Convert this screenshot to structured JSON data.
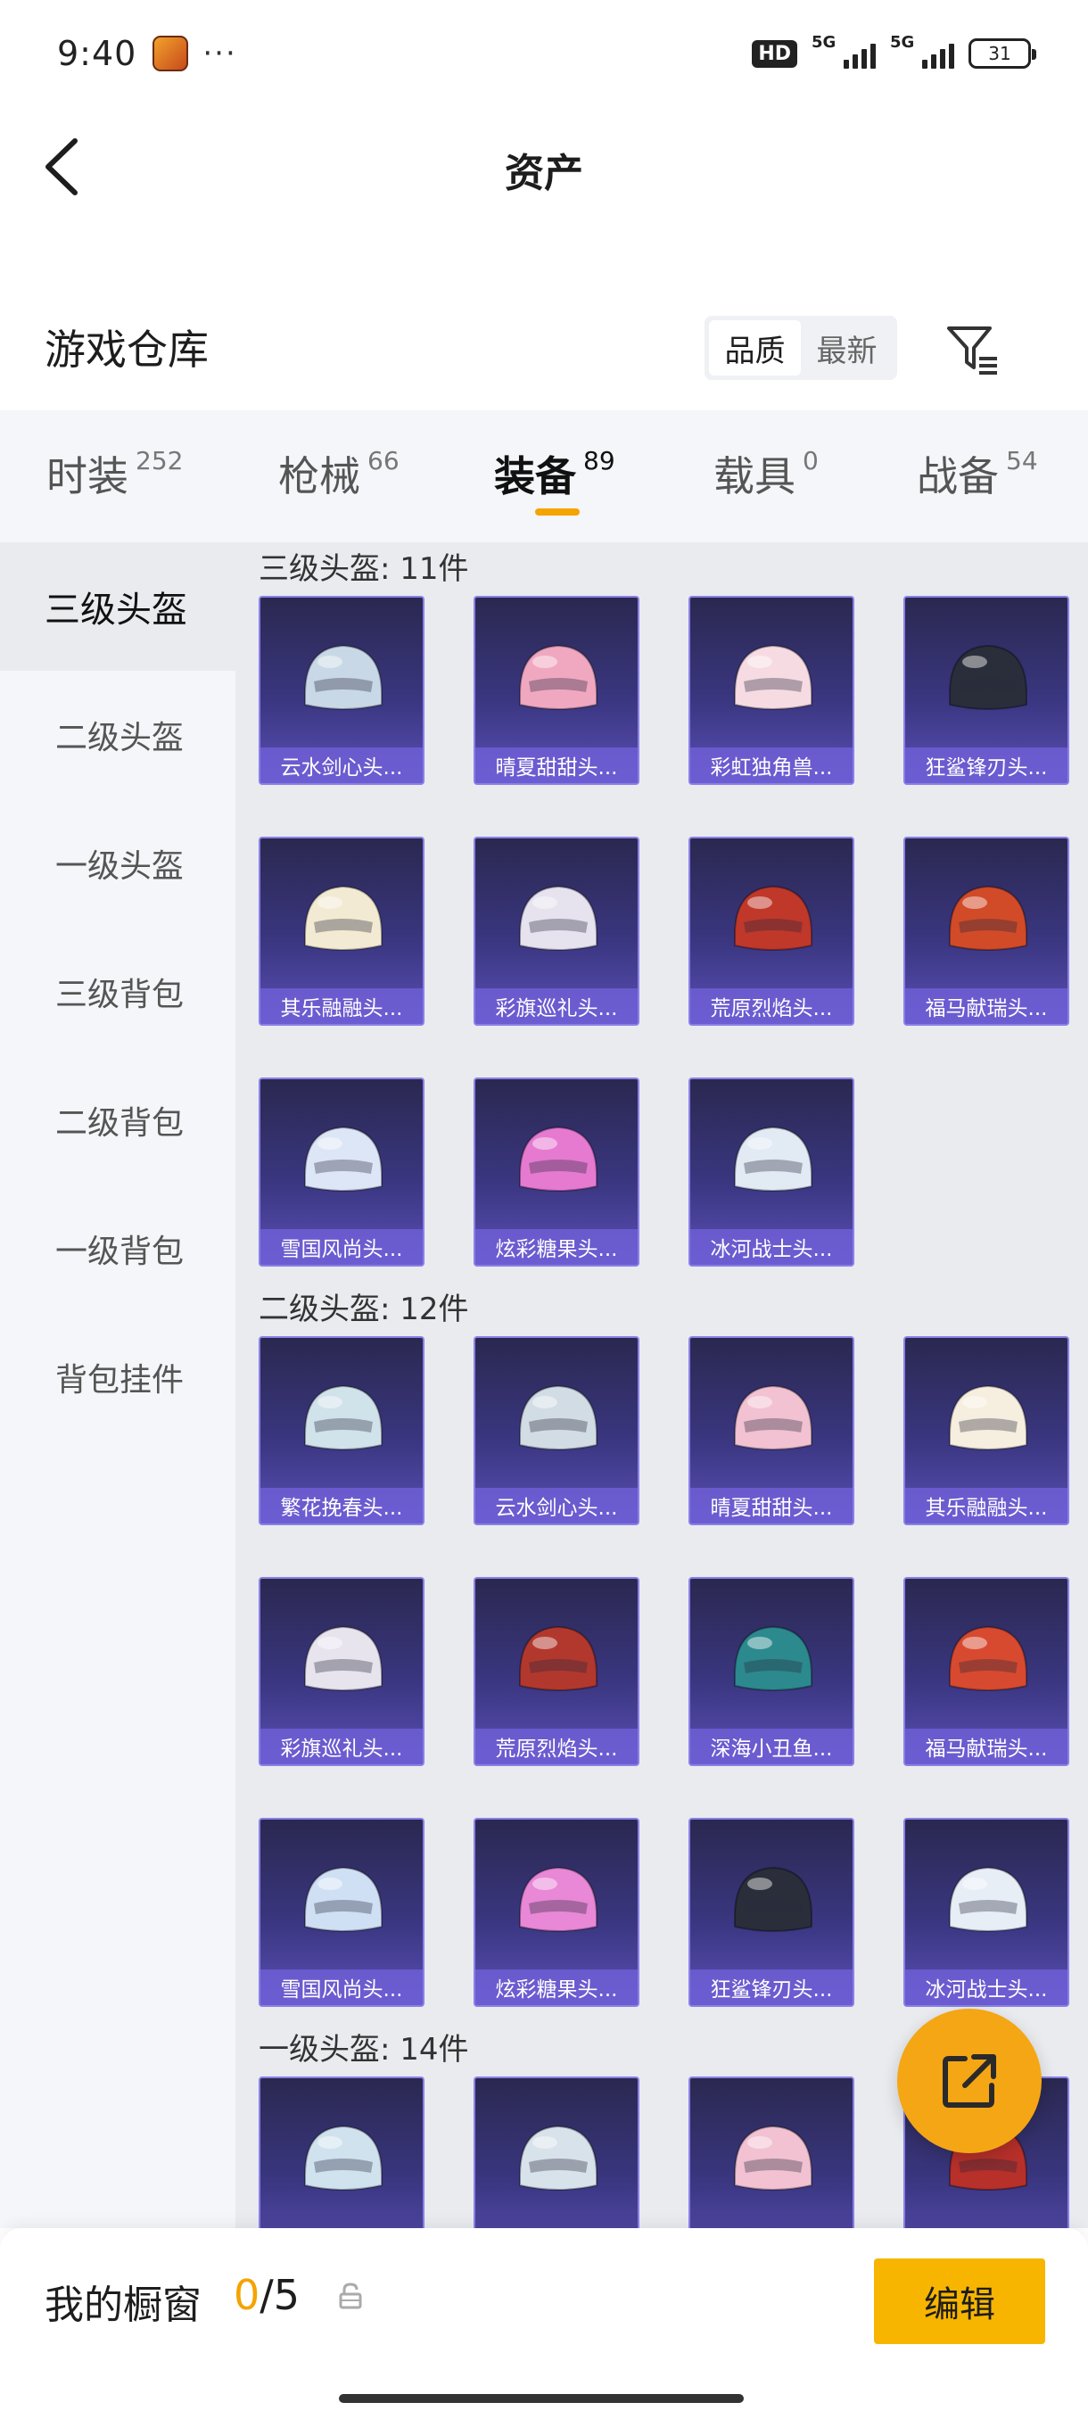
{
  "status_bar": {
    "time": "9:40",
    "dots": "···",
    "hd": "HD",
    "network_a": "5G",
    "network_b": "5G",
    "battery": "31"
  },
  "header": {
    "title": "资产"
  },
  "warehouse": {
    "title": "游戏仓库",
    "sort_options": [
      {
        "label": "品质",
        "active": true
      },
      {
        "label": "最新",
        "active": false
      }
    ]
  },
  "tabs": [
    {
      "label": "时装",
      "count": "252"
    },
    {
      "label": "枪械",
      "count": "66"
    },
    {
      "label": "装备",
      "count": "89",
      "active": true
    },
    {
      "label": "载具",
      "count": "0"
    },
    {
      "label": "战备",
      "count": "54"
    }
  ],
  "sidebar": [
    {
      "label": "三级头盔",
      "active": true
    },
    {
      "label": "二级头盔"
    },
    {
      "label": "一级头盔"
    },
    {
      "label": "三级背包"
    },
    {
      "label": "二级背包"
    },
    {
      "label": "一级背包"
    },
    {
      "label": "背包挂件"
    }
  ],
  "sections": [
    {
      "title": "三级头盔: 11件",
      "items": [
        {
          "name": "云水剑心头...",
          "color": "#c8d8e6"
        },
        {
          "name": "晴夏甜甜头...",
          "color": "#f0a8c0"
        },
        {
          "name": "彩虹独角兽...",
          "color": "#f6dce2"
        },
        {
          "name": "狂鲨锋刃头...",
          "color": "#2a2e3a"
        },
        {
          "name": "其乐融融头...",
          "color": "#f2ead2"
        },
        {
          "name": "彩旗巡礼头...",
          "color": "#e6e2ee"
        },
        {
          "name": "荒原烈焰头...",
          "color": "#c0382a"
        },
        {
          "name": "福马献瑞头...",
          "color": "#d24b28"
        },
        {
          "name": "雪国风尚头...",
          "color": "#dde6f6"
        },
        {
          "name": "炫彩糖果头...",
          "color": "#e67ad0"
        },
        {
          "name": "冰河战士头...",
          "color": "#e2eaf4"
        }
      ]
    },
    {
      "title": "二级头盔: 12件",
      "items": [
        {
          "name": "繁花挽春头...",
          "color": "#d0e2ea"
        },
        {
          "name": "云水剑心头...",
          "color": "#d2dce4"
        },
        {
          "name": "晴夏甜甜头...",
          "color": "#f2c2d2"
        },
        {
          "name": "其乐融融头...",
          "color": "#f6eede"
        },
        {
          "name": "彩旗巡礼头...",
          "color": "#e8e4ee"
        },
        {
          "name": "荒原烈焰头...",
          "color": "#b2382e"
        },
        {
          "name": "深海小丑鱼...",
          "color": "#2c8a8e"
        },
        {
          "name": "福马献瑞头...",
          "color": "#d84a30"
        },
        {
          "name": "雪国风尚头...",
          "color": "#cfe0f4"
        },
        {
          "name": "炫彩糖果头...",
          "color": "#e888d6"
        },
        {
          "name": "狂鲨锋刃头...",
          "color": "#2a2e3a"
        },
        {
          "name": "冰河战士头...",
          "color": "#e8eef6"
        }
      ]
    },
    {
      "title": "一级头盔: 14件",
      "items": [
        {
          "name": "",
          "color": "#cfe2ee"
        },
        {
          "name": "",
          "color": "#d8e2ea"
        },
        {
          "name": "",
          "color": "#f2c2d2"
        },
        {
          "name": "",
          "color": "#b8302a"
        }
      ]
    }
  ],
  "bottom_bar": {
    "label": "我的橱窗",
    "current": "0",
    "separator": "/",
    "total": "5",
    "edit_label": "编辑"
  }
}
